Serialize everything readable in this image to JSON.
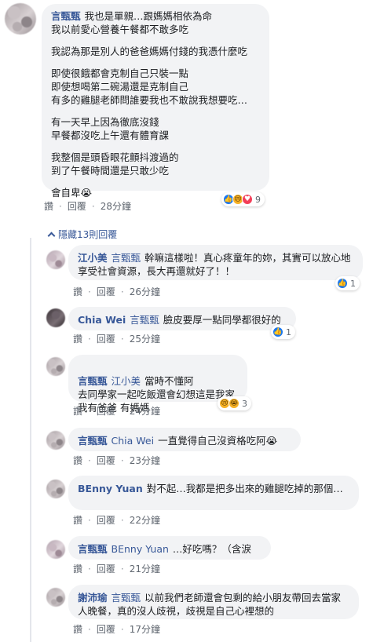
{
  "main_comment": {
    "author": "言甄甄",
    "paragraphs": [
      "我也是單親…跟媽媽相依為命\n我以前愛心營養午餐都不敢多吃",
      "我認為那是別人的爸爸媽媽付錢的我憑什麼吃",
      "即使很餓都會克制自己只裝一點\n即使想喝第二碗湯還是克制自己\n有多的雞腿老師問誰要我也不敢說我想要吃…",
      "有一天早上因為徹底沒錢\n早餐都沒吃上午還有體育課",
      "我整個是頭昏眼花顫抖渡過的\n到了午餐時間還是只敢少吃",
      "會自卑😭"
    ],
    "like": "讚",
    "reply": "回覆",
    "time": "28分鐘",
    "reactions": 9
  },
  "hidden_replies": "隱藏13則回覆",
  "replies": [
    {
      "author": "江小美",
      "tag": "言甄甄",
      "text": "幹嘛這樣啦！真心疼童年的妳，其實可以放心地享受社會資源，長大再還就好了！！",
      "like": "讚",
      "reply": "回覆",
      "time": "26分鐘",
      "reactions": 1
    },
    {
      "author": "Chia Wei",
      "tag": "言甄甄",
      "text": "臉皮要厚一點同學都很好的",
      "like": "讚",
      "reply": "回覆",
      "time": "25分鐘",
      "reactions": 1
    },
    {
      "author": "言甄甄",
      "tag": "江小美",
      "text": "當時不懂阿\n去同學家一起吃飯還會幻想這是我家\n我有爸爸 有媽媽",
      "like": "讚",
      "reply": "回覆",
      "time": "24分鐘",
      "reactions": 3
    },
    {
      "author": "言甄甄",
      "tag": "Chia Wei",
      "text": "一直覺得自己沒資格吃阿😭",
      "like": "讚",
      "reply": "回覆",
      "time": "23分鐘"
    },
    {
      "author": "BEnny Yuan",
      "tag": "",
      "text": "對不起…我都是把多出來的雞腿吃掉的那個…",
      "like": "讚",
      "reply": "回覆",
      "time": "22分鐘"
    },
    {
      "author": "言甄甄",
      "tag": "BEnny Yuan",
      "text": "…好吃嗎？（含淚",
      "like": "讚",
      "reply": "回覆",
      "time": "21分鐘"
    },
    {
      "author": "謝沛瑜",
      "tag": "言甄甄",
      "text": "以前我們老師還會包剩的給小朋友帶回去當家人晚餐，真的沒人歧視，歧視是自己心裡想的",
      "like": "讚",
      "reply": "回覆",
      "time": "17分鐘"
    }
  ],
  "colors": {
    "link": "#385898",
    "bubble": "#f2f3f5",
    "meta": "#606770",
    "like_blue": "#1877f2"
  }
}
